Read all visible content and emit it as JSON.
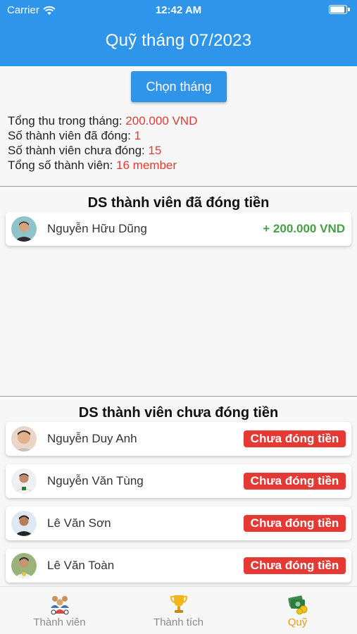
{
  "status_bar": {
    "carrier": "Carrier",
    "time": "12:42 AM",
    "wifi_icon": "wifi-icon",
    "battery_icon": "battery-icon"
  },
  "header": {
    "title": "Quỹ tháng 07/2023",
    "background": "#2f95ea"
  },
  "month_button": {
    "label": "Chọn tháng"
  },
  "stats": {
    "total_income_label": "Tổng thu trong tháng: ",
    "total_income_value": "200.000 VND",
    "paid_count_label": "Số thành viên đã đóng: ",
    "paid_count_value": "1",
    "unpaid_count_label": "Số thành viên chưa đóng: ",
    "unpaid_count_value": "15",
    "total_members_label": "Tổng số thành viên: ",
    "total_members_value": "16 member",
    "value_color": "#e53935"
  },
  "paid_section": {
    "title": "DS thành viên đã đóng tiền",
    "members": [
      {
        "name": "Nguyễn Hữu Dũng",
        "amount": "+ 200.000 VND",
        "avatar": "avatar-photo"
      }
    ],
    "amount_color": "#43a047"
  },
  "unpaid_section": {
    "title": "DS thành viên chưa đóng tiền",
    "badge_label": "Chưa đóng tiền",
    "badge_color": "#e53935",
    "members": [
      {
        "name": "Nguyễn Duy Anh",
        "badge": "Chưa đóng tiền",
        "avatar": "avatar-photo"
      },
      {
        "name": "Nguyễn Văn Tùng",
        "badge": "Chưa đóng tiền",
        "avatar": "avatar-photo"
      },
      {
        "name": "Lê Văn Sơn",
        "badge": "Chưa đóng tiền",
        "avatar": "avatar-photo"
      },
      {
        "name": "Lê Văn Toàn",
        "badge": "Chưa đóng tiền",
        "avatar": "avatar-photo"
      }
    ]
  },
  "tabs": [
    {
      "label": "Thành viên",
      "icon": "team-icon",
      "active": false
    },
    {
      "label": "Thành tích",
      "icon": "trophy-icon",
      "active": false
    },
    {
      "label": "Quỹ",
      "icon": "money-icon",
      "active": true
    }
  ],
  "active_tab_color": "#ef9a13"
}
